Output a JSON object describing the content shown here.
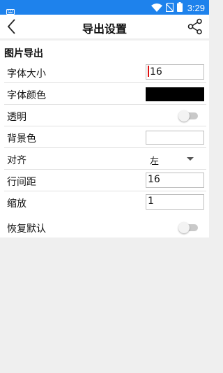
{
  "status_bar": {
    "time": "3:29",
    "icons": [
      "keyboard-icon",
      "wifi-icon",
      "no-sim-icon",
      "battery-icon"
    ]
  },
  "header": {
    "title": "导出设置",
    "back_icon": "chevron-left-icon",
    "share_icon": "share-icon"
  },
  "section": {
    "title": "图片导出"
  },
  "settings": {
    "font_size_label": "字体大小",
    "font_size_value": "16",
    "font_color_label": "字体颜色",
    "font_color_value": "#000000",
    "transparent_label": "透明",
    "background_label": "背景色",
    "align_label": "对齐",
    "align_value": "左",
    "line_spacing_label": "行间距",
    "line_spacing_value": "16",
    "zoom_label": "缩放",
    "zoom_value": "1",
    "reset_label": "恢复默认"
  },
  "colors": {
    "status_bar": "#1e82ec",
    "page_bg": "#efefef",
    "toggle_off": "#c9c9c9"
  }
}
